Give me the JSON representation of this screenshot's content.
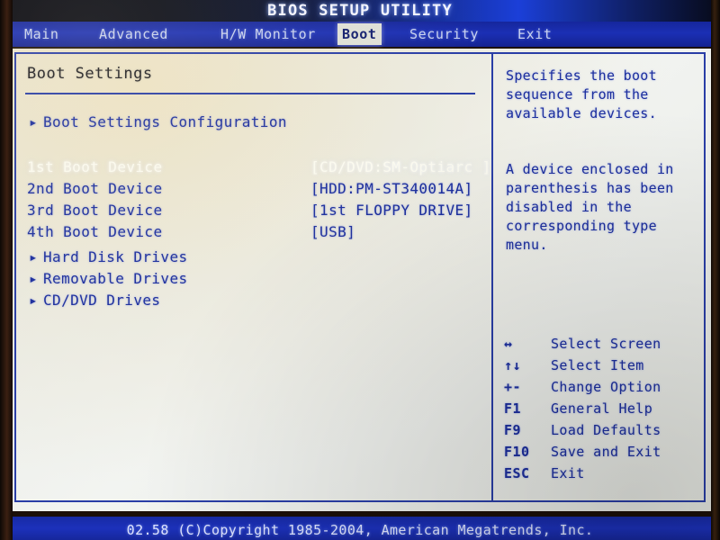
{
  "window": {
    "title": "BIOS SETUP UTILITY"
  },
  "menubar": {
    "tabs": [
      {
        "label": "Main",
        "active": false
      },
      {
        "label": "Advanced",
        "active": false
      },
      {
        "label": "H/W Monitor",
        "active": false
      },
      {
        "label": "Boot",
        "active": true
      },
      {
        "label": "Security",
        "active": false
      },
      {
        "label": "Exit",
        "active": false
      }
    ]
  },
  "main": {
    "section_title": "Boot Settings",
    "submenu_top": {
      "arrow": "▸",
      "label": "Boot Settings Configuration"
    },
    "boot_devices": [
      {
        "label": "1st Boot Device",
        "value": "[CD/DVD:SM-Optiarc ]",
        "selected": true
      },
      {
        "label": "2nd Boot Device",
        "value": "[HDD:PM-ST340014A]",
        "selected": false
      },
      {
        "label": "3rd Boot Device",
        "value": "[1st FLOPPY DRIVE]",
        "selected": false
      },
      {
        "label": "4th Boot Device",
        "value": "[USB]",
        "selected": false
      }
    ],
    "drive_submenus": [
      {
        "arrow": "▸",
        "label": "Hard Disk Drives"
      },
      {
        "arrow": "▸",
        "label": "Removable Drives"
      },
      {
        "arrow": "▸",
        "label": "CD/DVD Drives"
      }
    ]
  },
  "help": {
    "paragraph_1": "Specifies the boot sequence from the available devices.",
    "paragraph_2": "A device enclosed in parenthesis has been disabled in the corresponding type menu."
  },
  "legend": [
    {
      "key": "↔",
      "desc": "Select Screen",
      "icon": "left-right-arrow-icon"
    },
    {
      "key": "↑↓",
      "desc": "Select Item",
      "icon": "up-down-arrow-icon"
    },
    {
      "key": "+-",
      "desc": "Change Option",
      "icon": "plus-minus-icon"
    },
    {
      "key": "F1",
      "desc": "General Help",
      "icon": "f1-key"
    },
    {
      "key": "F9",
      "desc": "Load Defaults",
      "icon": "f9-key"
    },
    {
      "key": "F10",
      "desc": "Save and Exit",
      "icon": "f10-key"
    },
    {
      "key": "ESC",
      "desc": "Exit",
      "icon": "esc-key"
    }
  ],
  "footer": {
    "text": "02.58 (C)Copyright 1985-2004, American Megatrends, Inc."
  },
  "colors": {
    "title_bar_blue": "#132a8d",
    "menu_blue": "#1b2fb4",
    "panel_bg": "#eceeea",
    "text_blue": "#1d2f9e",
    "selected_text": "#fbfaf0",
    "border_blue": "#2a3ea6",
    "active_tab_bg": "#dfe0d8"
  }
}
